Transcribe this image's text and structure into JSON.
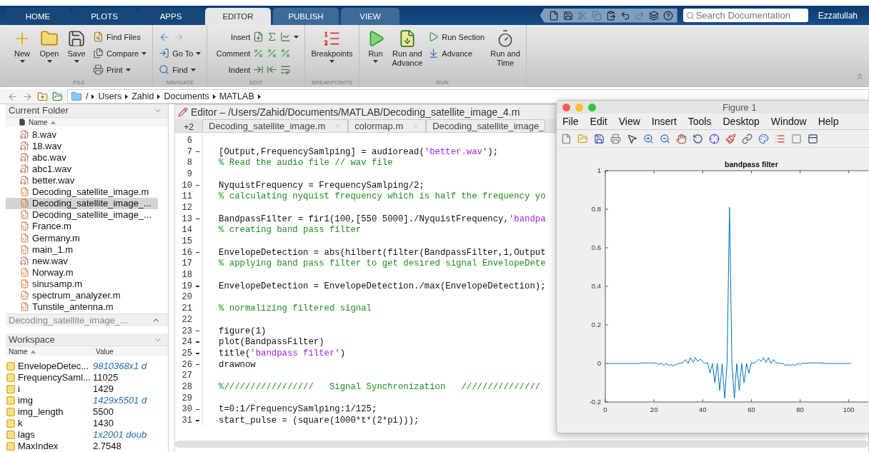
{
  "ribbon_tabs": [
    {
      "label": "HOME",
      "selected": false,
      "contextual": false
    },
    {
      "label": "PLOTS",
      "selected": false,
      "contextual": false
    },
    {
      "label": "APPS",
      "selected": false,
      "contextual": false
    },
    {
      "label": "EDITOR",
      "selected": true,
      "contextual": true
    },
    {
      "label": "PUBLISH",
      "selected": false,
      "contextual": true
    },
    {
      "label": "VIEW",
      "selected": false,
      "contextual": true
    }
  ],
  "quick_access": [
    {
      "disabled": false
    },
    {
      "disabled": false
    },
    {
      "disabled": true
    },
    {
      "disabled": true
    },
    {
      "disabled": false
    },
    {
      "disabled": false
    },
    {
      "disabled": true
    },
    {
      "disabled": false
    },
    {
      "disabled": false
    }
  ],
  "search": {
    "placeholder": "Search Documentation"
  },
  "user": "Ezzatullah",
  "ribbon": [
    {
      "title": "FILE",
      "columns": [
        {
          "kind": "large",
          "label": "New",
          "caret": true
        },
        {
          "kind": "large",
          "label": "Open",
          "caret": true
        },
        {
          "kind": "large",
          "label": "Save",
          "caret": true
        },
        {
          "kind": "stack",
          "rows": [
            {
              "kind": "button",
              "label": "Find Files",
              "caret": false
            },
            {
              "kind": "button",
              "label": "Compare",
              "caret": true
            },
            {
              "kind": "button",
              "label": "Print",
              "caret": true
            }
          ]
        }
      ]
    },
    {
      "title": "NAVIGATE",
      "columns": [
        {
          "kind": "stack",
          "rows": [
            {
              "kind": "nav"
            },
            {
              "kind": "button",
              "label": "Go To",
              "caret": true
            },
            {
              "kind": "button",
              "label": "Find",
              "caret": true
            }
          ]
        }
      ]
    },
    {
      "title": "EDIT",
      "columns": [
        {
          "kind": "stack",
          "rows": [
            {
              "kind": "tools",
              "label": "Insert",
              "caret": true
            },
            {
              "kind": "tools",
              "label": "Comment",
              "caret": false
            },
            {
              "kind": "tools",
              "label": "Indent",
              "caret": false
            }
          ]
        }
      ]
    },
    {
      "title": "BREAKPOINTS",
      "columns": [
        {
          "kind": "large",
          "label": "Breakpoints",
          "caret": true
        }
      ]
    },
    {
      "title": "RUN",
      "columns": [
        {
          "kind": "large",
          "label": "Run",
          "caret": true
        },
        {
          "kind": "large",
          "label": "Run and\nAdvance",
          "caret": false
        },
        {
          "kind": "stack",
          "rows": [
            {
              "kind": "button",
              "label": "Run Section",
              "caret": false
            },
            {
              "kind": "button",
              "label": "Advance",
              "caret": false
            }
          ]
        },
        {
          "kind": "large",
          "label": "Run and\nTime",
          "caret": false
        }
      ]
    }
  ],
  "address_bar": {
    "path": [
      "/",
      "Users",
      "Zahid",
      "Documents",
      "MATLAB"
    ]
  },
  "current_folder": {
    "title": "Current Folder",
    "column": "Name",
    "files": [
      {
        "name": "8.wav",
        "kind": "audio",
        "selected": false
      },
      {
        "name": "18.wav",
        "kind": "audio",
        "selected": false
      },
      {
        "name": "abc.wav",
        "kind": "audio",
        "selected": false
      },
      {
        "name": "abc1.wav",
        "kind": "audio",
        "selected": false
      },
      {
        "name": "better.wav",
        "kind": "audio",
        "selected": false
      },
      {
        "name": "Decoding_satellite_image.m",
        "kind": "script",
        "selected": false
      },
      {
        "name": "Decoding_satellite_image_...",
        "kind": "script",
        "selected": true
      },
      {
        "name": "Decoding_satellite_image_...",
        "kind": "script",
        "selected": false
      },
      {
        "name": "France.m",
        "kind": "script",
        "selected": false
      },
      {
        "name": "Germany.m",
        "kind": "script",
        "selected": false
      },
      {
        "name": "main_1.m",
        "kind": "script",
        "selected": false
      },
      {
        "name": "new.wav",
        "kind": "audio",
        "selected": false
      },
      {
        "name": "Norway.m",
        "kind": "script",
        "selected": false
      },
      {
        "name": "sinusamp.m",
        "kind": "script",
        "selected": false
      },
      {
        "name": "spectrum_analyzer.m",
        "kind": "script",
        "selected": false
      },
      {
        "name": "Tunstile_antenna.m",
        "kind": "script",
        "selected": false
      }
    ],
    "details": "Decoding_satellite_image_..."
  },
  "workspace": {
    "title": "Workspace",
    "columns": [
      "Name",
      "Value"
    ],
    "rows": [
      {
        "name": "EnvelopeDetec...",
        "value": "9810368x1 d",
        "kind": "array"
      },
      {
        "name": "FrequencySaml...",
        "value": "11025",
        "kind": "scalar"
      },
      {
        "name": "i",
        "value": "1429",
        "kind": "scalar"
      },
      {
        "name": "img",
        "value": "1429x5501 d",
        "kind": "array"
      },
      {
        "name": "img_length",
        "value": "5500",
        "kind": "scalar"
      },
      {
        "name": "k",
        "value": "1430",
        "kind": "scalar"
      },
      {
        "name": "lags",
        "value": "1x2001 doub",
        "kind": "array"
      },
      {
        "name": "MaxIndex",
        "value": "2.7548",
        "kind": "scalar"
      }
    ]
  },
  "editor": {
    "title": "Editor – /Users/Zahid/Documents/MATLAB/Decoding_satellite_image_4.m",
    "overflow": "+2",
    "tabs": [
      {
        "label": "Decoding_satellite_image.m",
        "selected": false,
        "closable": true
      },
      {
        "label": "colormap.m",
        "selected": false,
        "closable": true
      },
      {
        "label": "Decoding_satellite_image_",
        "selected": false,
        "closable": false
      }
    ],
    "lines": [
      {
        "number": "6",
        "executable": false
      },
      {
        "number": "7",
        "executable": true,
        "tokens": [
          {
            "kind": "code",
            "text": "[Output,FrequencySamlping] = audioread("
          },
          {
            "kind": "string",
            "text": "'better.wav'"
          },
          {
            "kind": "code",
            "text": ");"
          }
        ]
      },
      {
        "number": "8",
        "executable": false,
        "tokens": [
          {
            "kind": "comment",
            "text": "% Read the audio file // wav file"
          }
        ]
      },
      {
        "number": "9",
        "executable": false
      },
      {
        "number": "10",
        "executable": true,
        "tokens": [
          {
            "kind": "code",
            "text": "NyquistFrequency = FrequencySamlping/2;"
          }
        ]
      },
      {
        "number": "11",
        "executable": false,
        "tokens": [
          {
            "kind": "comment",
            "text": "% calculating nyquist frequency which is half the frequency yo"
          }
        ]
      },
      {
        "number": "12",
        "executable": false
      },
      {
        "number": "13",
        "executable": true,
        "tokens": [
          {
            "kind": "code",
            "text": "BandpassFilter = fir1(100,[550 5000]./NyquistFrequency,"
          },
          {
            "kind": "string",
            "text": "'bandpa"
          }
        ]
      },
      {
        "number": "14",
        "executable": false,
        "tokens": [
          {
            "kind": "comment",
            "text": "% creating band pass filter"
          }
        ]
      },
      {
        "number": "15",
        "executable": false
      },
      {
        "number": "16",
        "executable": true,
        "tokens": [
          {
            "kind": "code",
            "text": "EnvelopeDetection = abs(hilbert(filter(BandpassFilter,1,Output"
          }
        ]
      },
      {
        "number": "17",
        "executable": false,
        "tokens": [
          {
            "kind": "comment",
            "text": "% applying band pass filter to get desired signal EnvelopeDete"
          }
        ]
      },
      {
        "number": "18",
        "executable": false
      },
      {
        "number": "19",
        "executable": true,
        "tokens": [
          {
            "kind": "code",
            "text": "EnvelopeDetection = EnvelopeDetection./max(EnvelopeDetection);"
          }
        ]
      },
      {
        "number": "20",
        "executable": false
      },
      {
        "number": "21",
        "executable": false,
        "tokens": [
          {
            "kind": "comment",
            "text": "% normalizing filtered signal"
          }
        ]
      },
      {
        "number": "22",
        "executable": false
      },
      {
        "number": "23",
        "executable": true,
        "tokens": [
          {
            "kind": "code",
            "text": "figure(1)"
          }
        ]
      },
      {
        "number": "24",
        "executable": true,
        "tokens": [
          {
            "kind": "code",
            "text": "plot(BandpassFilter)"
          }
        ]
      },
      {
        "number": "25",
        "executable": true,
        "tokens": [
          {
            "kind": "code",
            "text": "title("
          },
          {
            "kind": "string",
            "text": "'bandpass filter'"
          },
          {
            "kind": "code",
            "text": ")"
          }
        ]
      },
      {
        "number": "26",
        "executable": true,
        "tokens": [
          {
            "kind": "code",
            "text": "drawnow"
          }
        ]
      },
      {
        "number": "27",
        "executable": false
      },
      {
        "number": "28",
        "executable": false,
        "tokens": [
          {
            "kind": "comment",
            "text": "%/////////////////   Signal Synchronization   ///////////////"
          }
        ]
      },
      {
        "number": "29",
        "executable": false
      },
      {
        "number": "30",
        "executable": true,
        "tokens": [
          {
            "kind": "code",
            "text": "t=0:1/FrequencySamlping:1/125;"
          }
        ]
      },
      {
        "number": "31",
        "executable": true,
        "tokens": [
          {
            "kind": "code",
            "text": "start_pulse = (square(1000*t*(2*pi)));"
          }
        ]
      }
    ]
  },
  "figure": {
    "title": "Figure 1",
    "menu": [
      "File",
      "Edit",
      "View",
      "Insert",
      "Tools",
      "Desktop",
      "Window",
      "Help"
    ],
    "chart_data": {
      "type": "line",
      "title": "bandpass filter",
      "xlim": [
        0,
        108
      ],
      "ylim": [
        -0.2,
        1
      ],
      "xticks": [
        0,
        20,
        40,
        60,
        80,
        100
      ],
      "yticks": [
        -0.2,
        0,
        0.2,
        0.4,
        0.6,
        0.8,
        1
      ],
      "x": [
        1,
        2,
        3,
        4,
        5,
        6,
        7,
        8,
        9,
        10,
        11,
        12,
        13,
        14,
        15,
        16,
        17,
        18,
        19,
        20,
        21,
        22,
        23,
        24,
        25,
        26,
        27,
        28,
        29,
        30,
        31,
        32,
        33,
        34,
        35,
        36,
        37,
        38,
        39,
        40,
        41,
        42,
        43,
        44,
        45,
        46,
        47,
        48,
        49,
        50,
        51,
        52,
        53,
        54,
        55,
        56,
        57,
        58,
        59,
        60,
        61,
        62,
        63,
        64,
        65,
        66,
        67,
        68,
        69,
        70,
        71,
        72,
        73,
        74,
        75,
        76,
        77,
        78,
        79,
        80,
        81,
        82,
        83,
        84,
        85,
        86,
        87,
        88,
        89,
        90,
        91,
        92,
        93,
        94,
        95,
        96,
        97,
        98,
        99,
        100,
        101
      ],
      "series": [
        {
          "color": "#0072bd",
          "values": [
            0,
            0,
            0,
            0,
            0,
            0,
            0,
            0,
            0,
            0,
            0,
            0,
            0,
            0,
            0.002,
            0.003,
            0.002,
            0.004,
            0.002,
            0.002,
            0.002,
            -0.005,
            0.002,
            -0.01,
            0,
            -0.01,
            -0.005,
            -0.012,
            -0.005,
            0,
            0.002,
            0.005,
            0.02,
            0,
            0.03,
            0.005,
            0.03,
            0.01,
            0.022,
            0.01,
            0,
            0.005,
            -0.05,
            0,
            -0.1,
            0,
            -0.14,
            0,
            -0.18,
            0,
            0.81,
            0,
            -0.18,
            0,
            -0.14,
            0,
            -0.1,
            0,
            -0.05,
            0.005,
            0,
            0.01,
            0.022,
            0.01,
            0.03,
            0.005,
            0.03,
            0,
            0.02,
            0.005,
            0.002,
            0,
            0,
            -0.01,
            -0.005,
            -0.012,
            -0.005,
            -0.01,
            0,
            -0.005,
            0.002,
            0.002,
            0.002,
            0.003,
            0.002,
            0.004,
            0.003,
            0.002,
            0.002,
            0.001,
            0,
            0,
            0,
            0,
            0,
            0,
            0,
            0,
            0,
            0,
            0
          ]
        }
      ]
    }
  }
}
